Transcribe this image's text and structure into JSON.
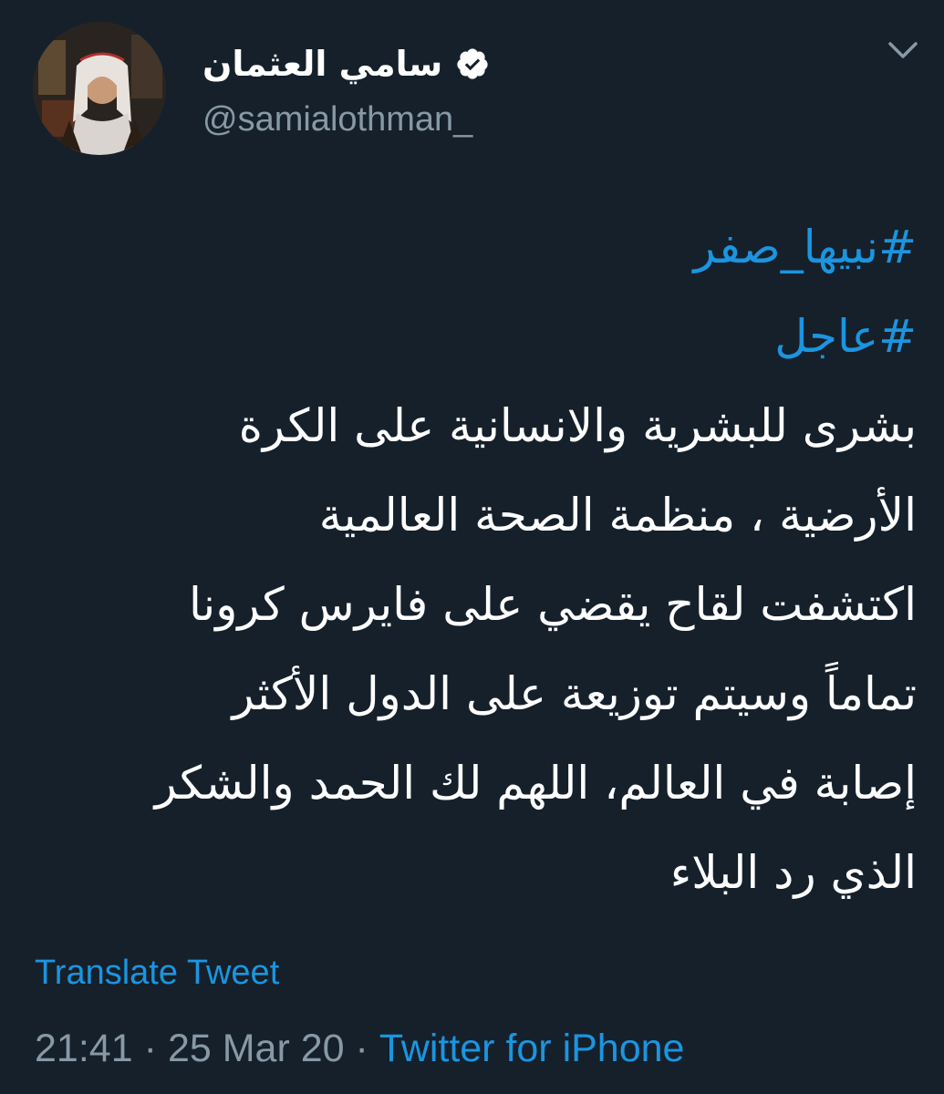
{
  "author": {
    "display_name": "سامي العثمان",
    "handle": "@samialothman_",
    "verified_icon": "verified-badge-icon"
  },
  "menu_icon": "chevron-down-icon",
  "tweet": {
    "hashtags": [
      "#نبيها_صفر",
      "#عاجل"
    ],
    "lines": [
      "بشرى للبشرية والانسانية على الكرة",
      "الأرضية ، منظمة الصحة العالمية",
      "اكتشفت لقاح يقضي على فايرس كرونا",
      "تماماً وسيتم توزيعة على الدول الأكثر",
      "إصابة في العالم، اللهم لك الحمد والشكر",
      "الذي رد البلاء"
    ]
  },
  "footer": {
    "translate_label": "Translate Tweet",
    "time": "21:41",
    "separator": "·",
    "date": "25 Mar 20",
    "source": "Twitter for iPhone"
  },
  "colors": {
    "background": "#15202b",
    "accent": "#1b95e0",
    "secondary_text": "#8899a6",
    "primary_text": "#ffffff"
  }
}
